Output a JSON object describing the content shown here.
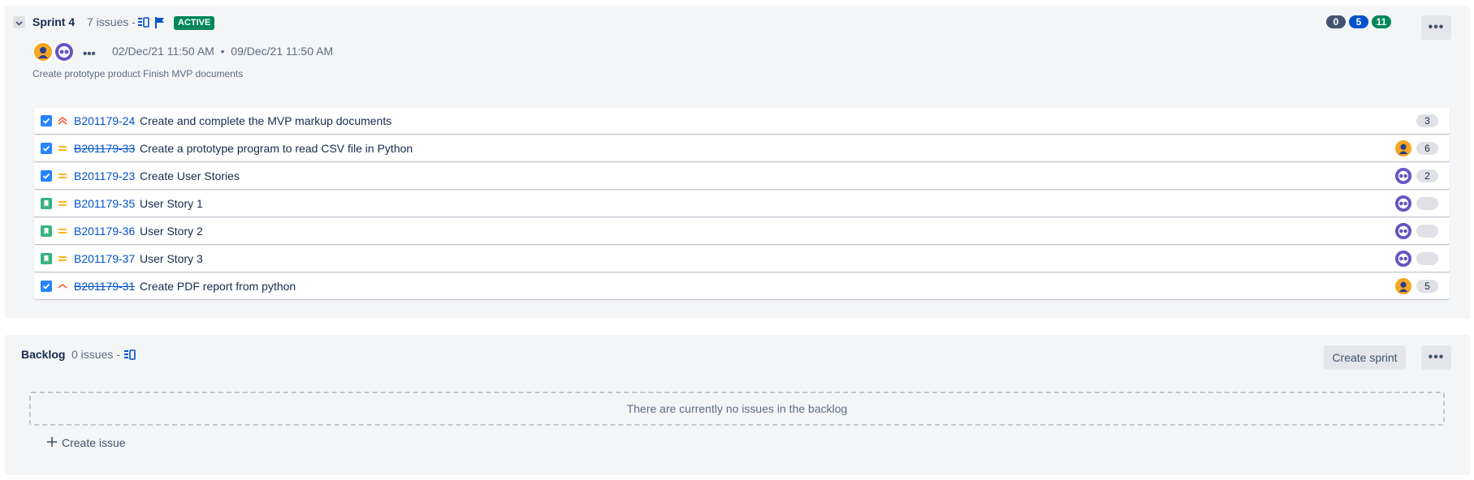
{
  "sprint": {
    "name": "Sprint 4",
    "issues_count": "7 issues -",
    "status": "ACTIVE",
    "dates": "02/Dec/21 11:50 AM  •  09/Dec/21 11:50 AM",
    "more_dots": "•••",
    "goal": "Create prototype product Finish MVP documents",
    "status_counts": [
      {
        "value": "0",
        "color": "#42526e"
      },
      {
        "value": "5",
        "color": "#0052cc"
      },
      {
        "value": "11",
        "color": "#00875a"
      }
    ],
    "menu_label": "•••"
  },
  "issues": [
    {
      "type": "task",
      "priority": "high",
      "key": "B201179-24",
      "summary": "Create and complete the MVP markup documents",
      "done": false,
      "avatar": "none",
      "points": "3"
    },
    {
      "type": "task",
      "priority": "medium",
      "key": "B201179-33",
      "summary": "Create a prototype program to read CSV file in Python",
      "done": true,
      "avatar": "orange",
      "points": "6"
    },
    {
      "type": "task",
      "priority": "medium",
      "key": "B201179-23",
      "summary": "Create User Stories",
      "done": false,
      "avatar": "purple",
      "points": "2"
    },
    {
      "type": "story",
      "priority": "medium",
      "key": "B201179-35",
      "summary": "User Story 1",
      "done": false,
      "avatar": "purple",
      "points": ""
    },
    {
      "type": "story",
      "priority": "medium",
      "key": "B201179-36",
      "summary": "User Story 2",
      "done": false,
      "avatar": "purple",
      "points": ""
    },
    {
      "type": "story",
      "priority": "medium",
      "key": "B201179-37",
      "summary": "User Story 3",
      "done": false,
      "avatar": "purple",
      "points": ""
    },
    {
      "type": "task",
      "priority": "low-up",
      "key": "B201179-31",
      "summary": "Create PDF report from python",
      "done": true,
      "avatar": "orange",
      "points": "5"
    }
  ],
  "backlog": {
    "title": "Backlog",
    "issues_count": "0 issues -",
    "create_sprint_label": "Create sprint",
    "menu_label": "•••",
    "empty_message": "There are currently no issues in the backlog",
    "create_issue_label": "Create issue"
  },
  "colors": {
    "panel_bg": "#f4f5f7",
    "link": "#0052cc",
    "active_lozenge": "#00875a",
    "task_icon": "#2684ff",
    "story_icon": "#36b37e",
    "priority_high": "#ff5630",
    "priority_medium": "#ffab00"
  }
}
